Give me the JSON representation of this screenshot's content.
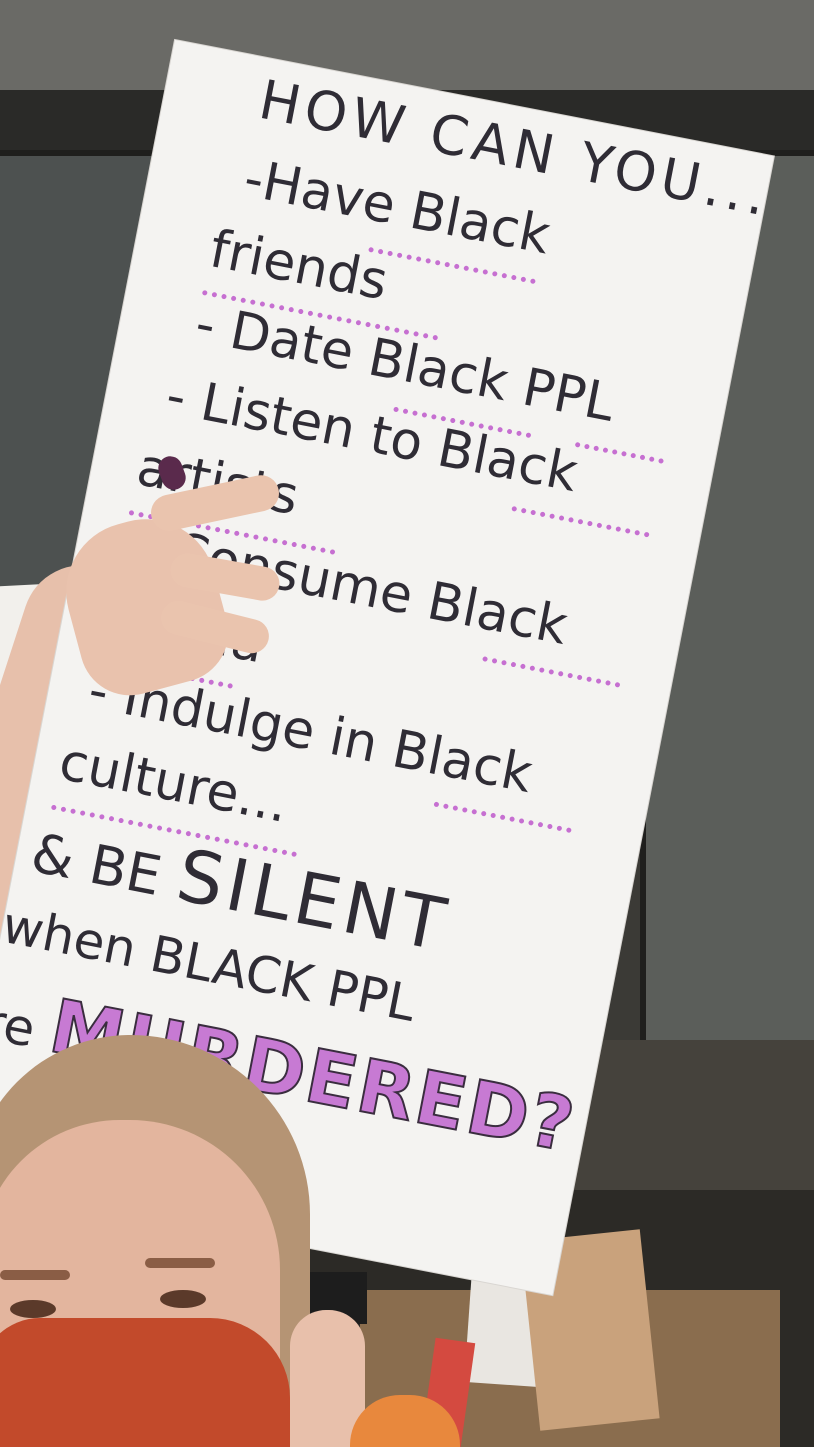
{
  "sign": {
    "lines": [
      "HOW CAN YOU...",
      "-Have Black",
      "friends",
      "- Date Black PPL",
      "- Listen to Black",
      "artists",
      "- Consume Black",
      "media",
      "- Indulge in Black",
      "culture...",
      "& BE ",
      "SILENT",
      "when BLACK PPL",
      "are ",
      "MURDERED?"
    ]
  },
  "colors": {
    "sign_background": "#f4f3f1",
    "marker_text": "#2f2c35",
    "accent_pink": "#c77ad3",
    "mask_red": "#c24a2b"
  }
}
